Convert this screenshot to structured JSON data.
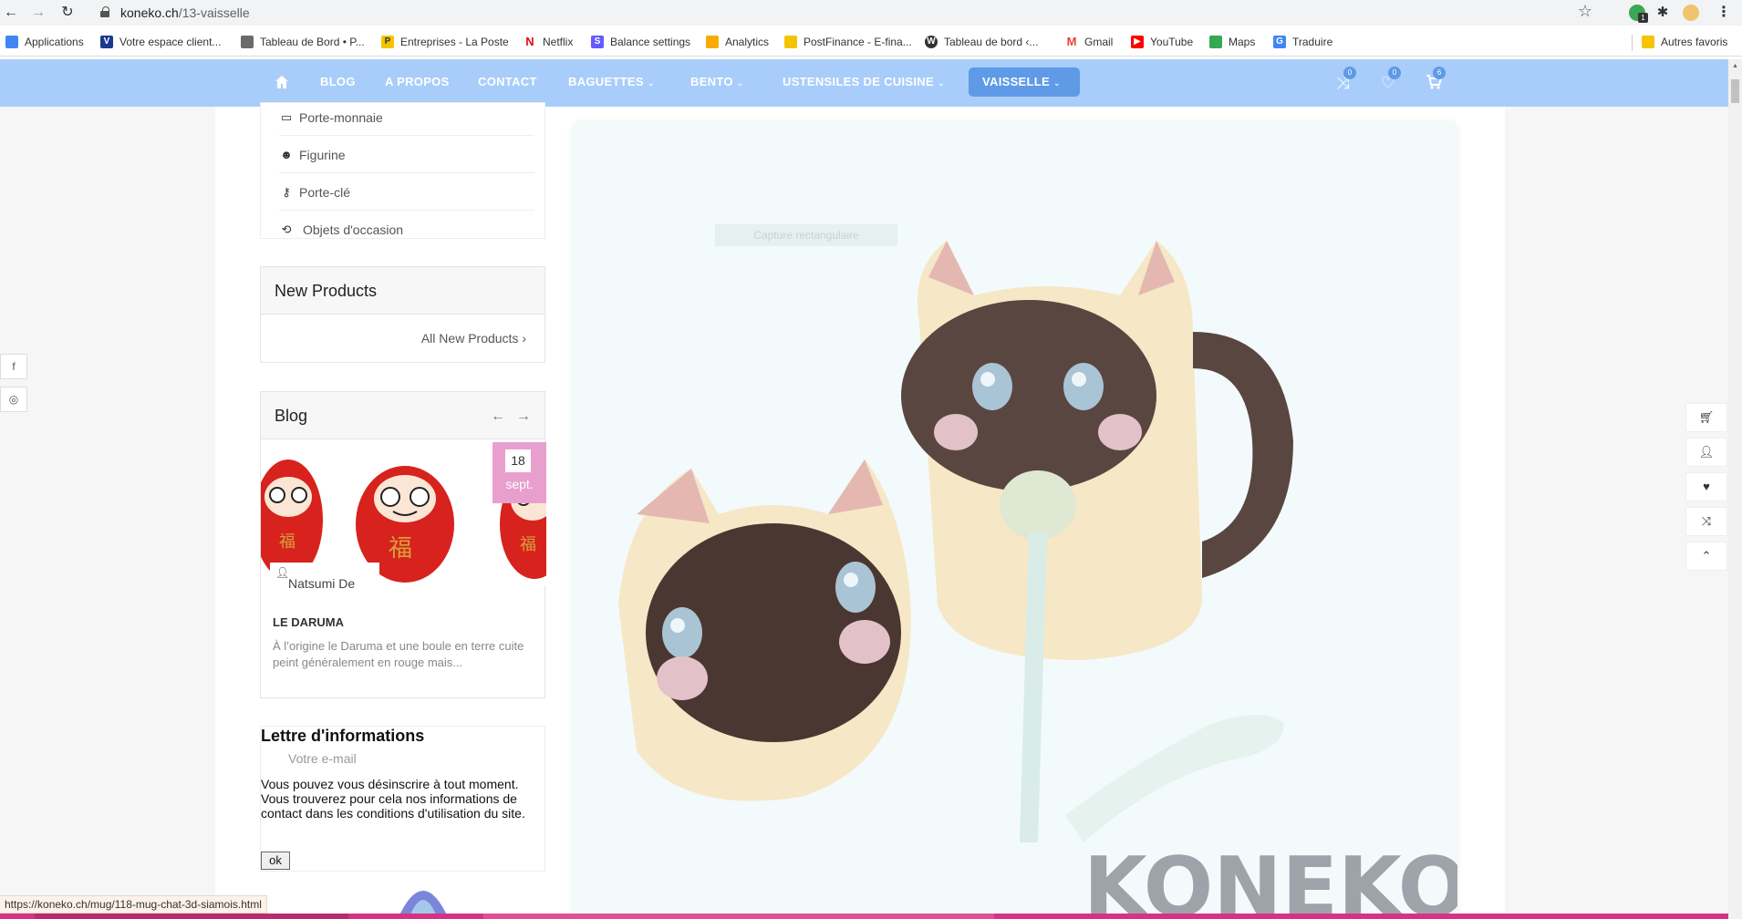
{
  "browser": {
    "url_host": "koneko.ch",
    "url_path": "/13-vaisselle",
    "status_url": "https://koneko.ch/mug/118-mug-chat-3d-siamois.html",
    "bookmarks": [
      {
        "label": "Applications",
        "icon": "apps-grid-icon",
        "color": "#4285f4"
      },
      {
        "label": "Votre espace client...",
        "icon": "vaudoise-icon",
        "color": "#1a3a8f"
      },
      {
        "label": "Tableau de Bord • P...",
        "icon": "dashboard-icon",
        "color": "#6a6a6a"
      },
      {
        "label": "Entreprises - La Poste",
        "icon": "la-poste-icon",
        "color": "#f5c400"
      },
      {
        "label": "Netflix",
        "icon": "netflix-icon",
        "color": "#e50914"
      },
      {
        "label": "Balance settings",
        "icon": "stripe-icon",
        "color": "#635bff"
      },
      {
        "label": "Analytics",
        "icon": "analytics-icon",
        "color": "#f9ab00"
      },
      {
        "label": "PostFinance - E-fina...",
        "icon": "postfinance-icon",
        "color": "#f5c400"
      },
      {
        "label": "Tableau de bord ‹...",
        "icon": "wordpress-icon",
        "color": "#333333"
      },
      {
        "label": "Gmail",
        "icon": "gmail-icon",
        "color": "#ea4335"
      },
      {
        "label": "YouTube",
        "icon": "youtube-icon",
        "color": "#ff0000"
      },
      {
        "label": "Maps",
        "icon": "maps-icon",
        "color": "#34a853"
      },
      {
        "label": "Traduire",
        "icon": "translate-icon",
        "color": "#4285f4"
      }
    ],
    "other_bookmarks": "Autres favoris",
    "extension_badge": "1"
  },
  "site_nav": {
    "items": [
      "BLOG",
      "A PROPOS",
      "CONTACT",
      "BAGUETTES",
      "BENTO",
      "USTENSILES DE CUISINE",
      "VAISSELLE"
    ],
    "compare_count": "0",
    "wishlist_count": "0",
    "cart_count": "6",
    "accent": "#a8cdfa",
    "active_color": "#5e9ae6"
  },
  "categories": [
    {
      "label": "Porte-monnaie",
      "icon": "wallet-icon"
    },
    {
      "label": "Figurine",
      "icon": "panda-icon"
    },
    {
      "label": "Porte-clé",
      "icon": "keychain-icon"
    },
    {
      "label": "Objets d'occasion",
      "icon": "recycle-icon"
    }
  ],
  "new_products": {
    "title": "New Products",
    "link": "All New Products"
  },
  "blog": {
    "title": "Blog",
    "day": "18",
    "month": "sept.",
    "author": "Natsumi De",
    "post_title": "LE DARUMA",
    "excerpt": "À l’origine le Daruma et une boule en terre cuite peint généralement en rouge mais..."
  },
  "newsletter": {
    "title": "Lettre d'informations",
    "placeholder": "Votre e-mail",
    "text": "Vous pouvez vous désinscrire à tout moment. Vous trouverez pour cela nos informations de contact dans les conditions d'utilisation du site.",
    "button": "ok"
  },
  "product": {
    "capture_label": "Capture rectangulaire",
    "watermark": "KONEKO"
  },
  "social": [
    "f",
    "instagram-icon"
  ],
  "floaters": [
    "cart-icon",
    "user-icon",
    "heart-icon",
    "shuffle-icon",
    "chevron-up-icon"
  ]
}
